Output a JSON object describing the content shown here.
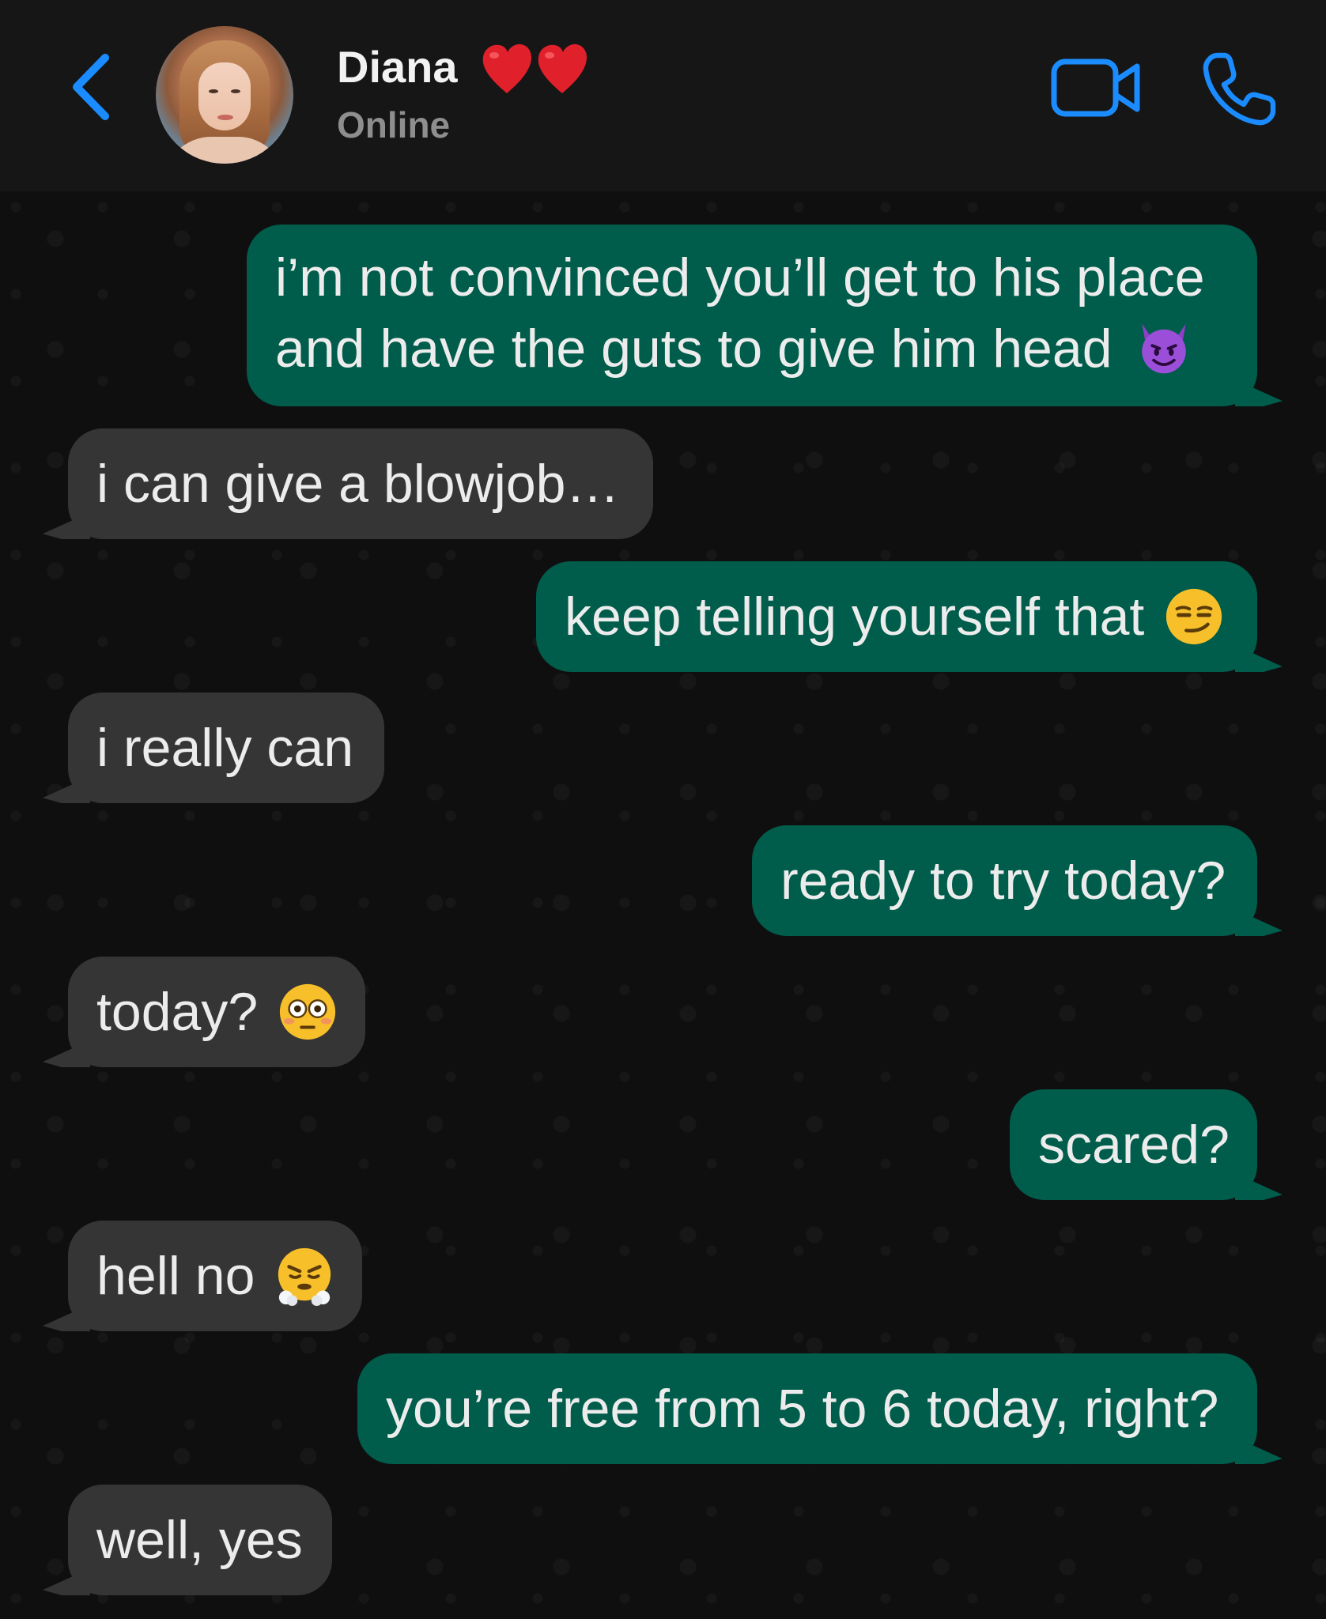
{
  "header": {
    "contact_name": "Diana",
    "status": "Online",
    "back_icon": "chevron-left-icon",
    "video_icon": "video-camera-icon",
    "call_icon": "phone-icon",
    "accent_color": "#1a8cff"
  },
  "messages": [
    {
      "direction": "out",
      "text": "i’m not convinced you’ll get to his place and have the guts to give him head",
      "emoji": "smiling-devil-emoji"
    },
    {
      "direction": "in",
      "text": "i can give a blowjob…"
    },
    {
      "direction": "out",
      "text": "keep telling yourself that",
      "emoji": "smirking-face-emoji"
    },
    {
      "direction": "in",
      "text": "i really can"
    },
    {
      "direction": "out",
      "text": "ready to try today?"
    },
    {
      "direction": "in",
      "text": "today?",
      "emoji": "flushed-face-emoji"
    },
    {
      "direction": "out",
      "text": "scared?"
    },
    {
      "direction": "in",
      "text": "hell no",
      "emoji": "face-with-steam-emoji"
    },
    {
      "direction": "out",
      "text": "you’re free from 5 to 6 today, right?"
    },
    {
      "direction": "in",
      "text": "well, yes"
    }
  ],
  "colors": {
    "outgoing_bubble": "#005c4b",
    "incoming_bubble": "#353535",
    "header_bg": "#161616"
  }
}
